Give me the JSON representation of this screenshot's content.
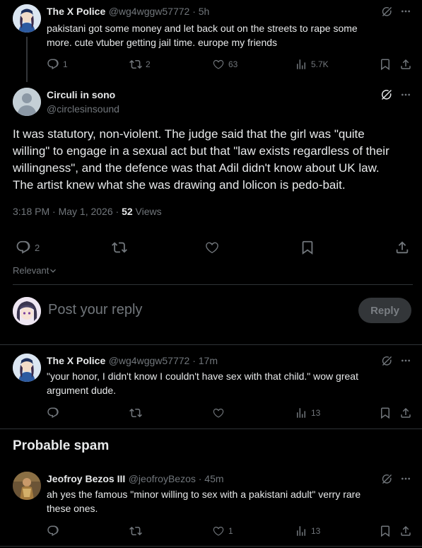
{
  "tweet1": {
    "name": "The X Police",
    "meta": "@wg4wggw57772 · 5h",
    "text_line1": "pakistani got some money and let back out on the streets to rape some",
    "text_line2": "more. cute vtuber getting jail time. europe my friends",
    "replies": "1",
    "reposts": "2",
    "likes": "63",
    "views": "5.7K"
  },
  "main": {
    "name": "Circuli in sono",
    "handle": "@circlesinsound",
    "lines": [
      "It was statutory, non-violent. The judge said that the girl was \"quite",
      "willing\" to engage in a sexual act but that \"law exists regardless of their",
      "willingness\", and the defence was that Adil didn't know about UK law.",
      "The artist knew what she was drawing and lolicon is pedo-bait."
    ],
    "timestamp": "3:18 PM · May 1, 2026 · ",
    "view_count": "52",
    "views_label": " Views",
    "replies": "2",
    "sort_label": "Relevant"
  },
  "composer": {
    "placeholder": "Post your reply",
    "button": "Reply"
  },
  "reply1": {
    "name": "The X Police",
    "meta": "@wg4wggw57772 · 17m",
    "text_line1": "\"your honor, I didn't know I couldn't have sex with that child.\" wow great",
    "text_line2": "argument dude.",
    "views": "13"
  },
  "section": {
    "title": "Probable spam"
  },
  "reply2": {
    "name": "Jeofroy Bezos III",
    "meta": "@jeofroyBezos · 45m",
    "text_line1": "ah yes the famous \"minor willing to sex with a pakistani adult\" verry rare",
    "text_line2": "these ones.",
    "likes": "1",
    "views": "13"
  },
  "icons": [
    "grok-icon",
    "more-icon",
    "reply-icon",
    "repost-icon",
    "like-icon",
    "views-icon",
    "bookmark-icon",
    "share-icon",
    "chevron-down-icon"
  ],
  "colors": {
    "background": "#000000",
    "text": "#e7e9ea",
    "secondary": "#71767b",
    "divider": "#2f3336",
    "reply_button_bg": "#333639"
  }
}
